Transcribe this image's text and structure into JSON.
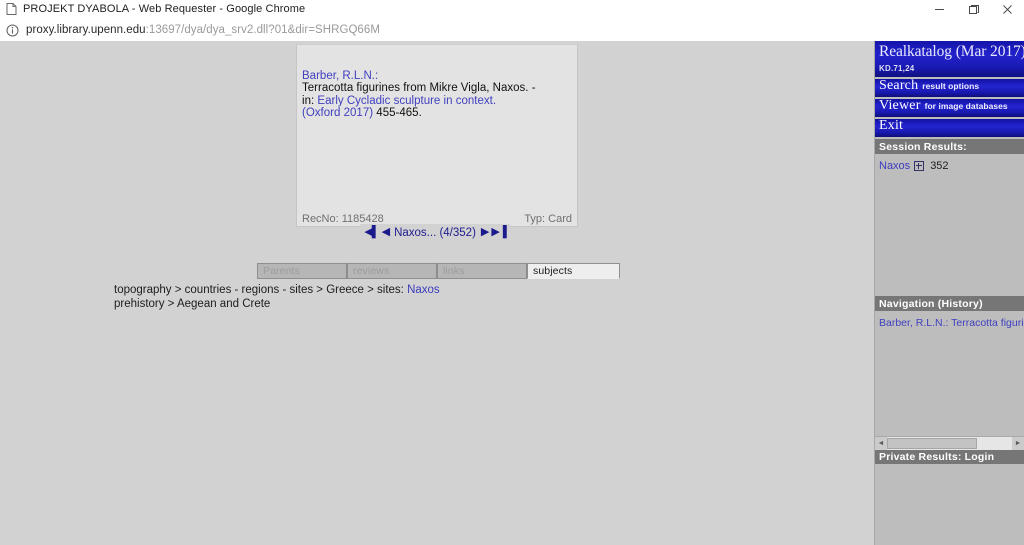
{
  "browser": {
    "tab_title": "PROJEKT DYABOLA - Web Requester - Google Chrome",
    "favicon": "page-icon",
    "url_host": "proxy.library.upenn.edu",
    "url_path": ":13697/dya/dya_srv2.dll?01&dir=SHRGQ66M",
    "site_info_icon": "info-circle-icon",
    "window_controls": {
      "minimize": "–",
      "maximize": "❐",
      "close": "×"
    }
  },
  "record_card": {
    "lines": [
      {
        "segments": [
          {
            "text": "Barber, R.L.N.:",
            "style": "link"
          }
        ]
      },
      {
        "segments": [
          {
            "text": "Terracotta figurines from Mikre Vigla, Naxos. -",
            "style": "plain"
          }
        ]
      },
      {
        "segments": [
          {
            "text": "in: ",
            "style": "plain"
          },
          {
            "text": "Early Cycladic sculpture in context.",
            "style": "link"
          }
        ]
      },
      {
        "segments": [
          {
            "text": "(Oxford 2017)",
            "style": "link"
          },
          {
            "text": " 455-465.",
            "style": "plain"
          }
        ]
      }
    ],
    "record_number_label": "RecNo: 1185428",
    "type_label": "Typ: Card"
  },
  "record_nav": {
    "first_icon": "◀▌",
    "prev_icon": "◀",
    "label": "Naxos... (4/352)",
    "next_icon": "▶",
    "last_icon": "▶▐"
  },
  "tabs": [
    {
      "label": "Parents",
      "state": "disabled"
    },
    {
      "label": "reviews",
      "state": "disabled"
    },
    {
      "label": "links",
      "state": "disabled"
    },
    {
      "label": "subjects",
      "state": "active"
    }
  ],
  "breadcrumbs": [
    {
      "segments": [
        {
          "text": "topography > countries - regions - sites > Greece > sites: ",
          "style": "plain"
        },
        {
          "text": "Naxos",
          "style": "link"
        }
      ]
    },
    {
      "segments": [
        {
          "text": "prehistory > Aegean and Crete",
          "style": "plain"
        }
      ]
    }
  ],
  "sidebar": {
    "brand": {
      "title": "Realkatalog (Mar 2017)",
      "subtitle": "KD.71,24"
    },
    "menu": [
      {
        "main": "Search",
        "sub": "result options"
      },
      {
        "main": "Viewer",
        "sub": "for image databases"
      },
      {
        "main": "Exit",
        "sub": ""
      }
    ],
    "session_results": {
      "header": "Session Results:",
      "items": [
        {
          "name": "Naxos",
          "expand_icon": "plus-box-icon",
          "count": "352"
        }
      ]
    },
    "navigation_history": {
      "header": "Navigation (History)",
      "items": [
        {
          "label": "Barber, R.L.N.: Terracotta figurin"
        }
      ]
    },
    "scrollbar": {
      "left_arrow": "◄",
      "right_arrow": "►"
    },
    "private_results": {
      "header": "Private Results: Login"
    }
  },
  "colors": {
    "page_background": "#d2d2d2",
    "sidebar_background": "#bdbdbd",
    "brand_blue": "#2222cc",
    "link_blue": "#4040c0",
    "panel_header_gray": "#767676",
    "card_background": "#e3e3e3"
  }
}
